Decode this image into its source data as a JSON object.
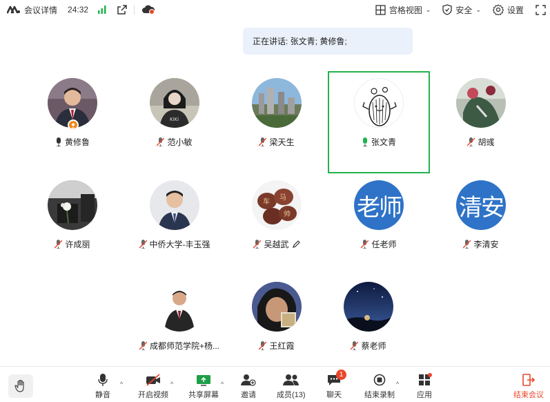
{
  "topbar": {
    "meeting_details": "会议详情",
    "timer": "24:32",
    "view_label": "宫格视图",
    "security_label": "安全",
    "settings_label": "设置"
  },
  "speaking": "正在讲话: 张文青; 黄修鲁;",
  "participants": [
    {
      "name": "黄修鲁",
      "mic": "on",
      "host": true
    },
    {
      "name": "范小敏",
      "mic": "muted"
    },
    {
      "name": "梁天生",
      "mic": "muted"
    },
    {
      "name": "张文青",
      "mic": "speaking",
      "active": true
    },
    {
      "name": "胡彧",
      "mic": "muted"
    },
    {
      "name": "许成丽",
      "mic": "muted"
    },
    {
      "name": "中侨大学-丰玉强",
      "mic": "muted"
    },
    {
      "name": "吴越武",
      "mic": "muted",
      "editing": true
    },
    {
      "name": "任老师",
      "mic": "muted",
      "avatar_text": "老师"
    },
    {
      "name": "李清安",
      "mic": "muted",
      "avatar_text": "清安"
    },
    {
      "name": "成都师范学院+杨...",
      "mic": "muted"
    },
    {
      "name": "王红霞",
      "mic": "muted"
    },
    {
      "name": "蔡老师",
      "mic": "muted"
    }
  ],
  "toolbar": {
    "mute": "静音",
    "video": "开启视频",
    "share": "共享屏幕",
    "invite": "邀请",
    "members": "成员(13)",
    "chat": "聊天",
    "chat_badge": "1",
    "record": "结束录制",
    "apps": "应用",
    "end": "结束会议"
  },
  "colors": {
    "accent_green": "#22b24c",
    "end_red": "#e8462c",
    "avatar_blue": "#2e73c8",
    "speaking_bg": "#eaf1fb"
  }
}
